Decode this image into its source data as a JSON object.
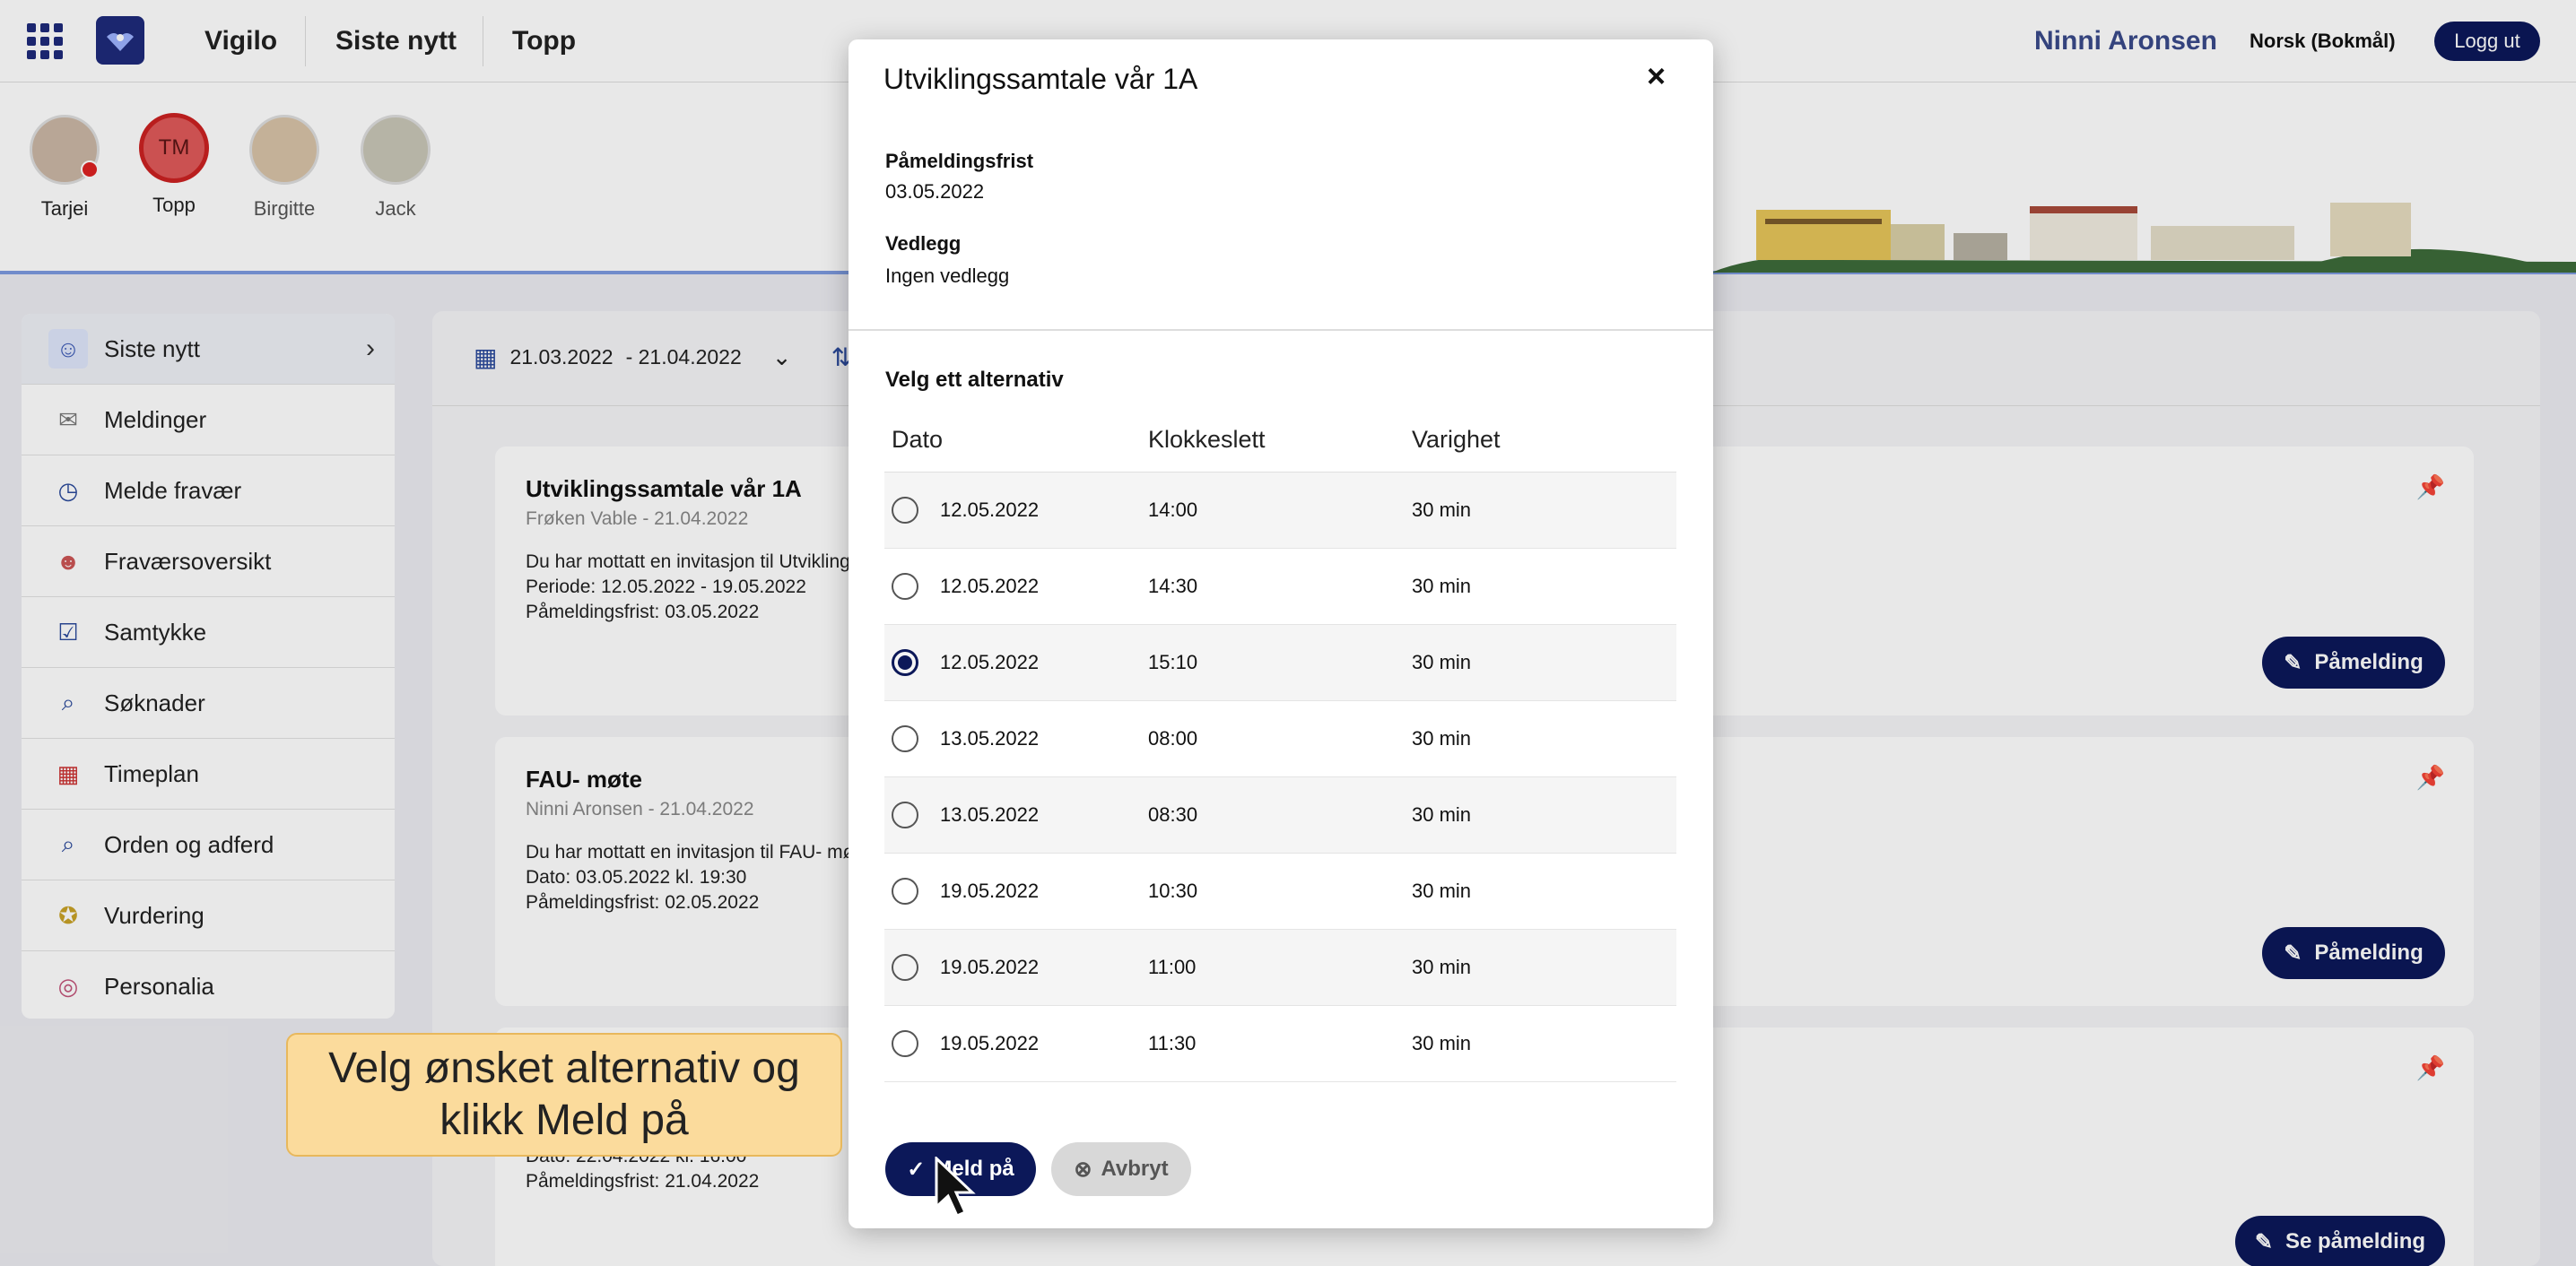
{
  "topnav": {
    "links": [
      "Vigilo",
      "Siste nytt",
      "Topp"
    ],
    "user": "Ninni Aronsen",
    "language": "Norsk (Bokmål)",
    "logout": "Logg ut"
  },
  "students": [
    {
      "name": "Tarjei"
    },
    {
      "name": "Topp",
      "initials": "TM"
    },
    {
      "name": "Birgitte"
    },
    {
      "name": "Jack"
    }
  ],
  "sidebar": {
    "items": [
      {
        "label": "Siste nytt",
        "icon": "news-person-icon"
      },
      {
        "label": "Meldinger",
        "icon": "envelope-icon"
      },
      {
        "label": "Melde fravær",
        "icon": "clock-icon"
      },
      {
        "label": "Fraværsoversikt",
        "icon": "absence-person-icon"
      },
      {
        "label": "Samtykke",
        "icon": "clipboard-icon"
      },
      {
        "label": "Søknader",
        "icon": "document-search-icon"
      },
      {
        "label": "Timeplan",
        "icon": "calendar-icon"
      },
      {
        "label": "Orden og adferd",
        "icon": "report-search-icon"
      },
      {
        "label": "Vurdering",
        "icon": "medal-icon"
      },
      {
        "label": "Personalia",
        "icon": "fingerprint-icon"
      }
    ]
  },
  "filter": {
    "date_from": "21.03.2022",
    "date_to": "- 21.04.2022"
  },
  "cards": [
    {
      "title": "Utviklingssamtale vår 1A",
      "sub": "Frøken Vable - 21.04.2022",
      "lines": [
        "Du har mottatt en invitasjon til Utvikling",
        "Periode: 12.05.2022 - 19.05.2022",
        "Påmeldingsfrist: 03.05.2022"
      ],
      "button": "Påmelding"
    },
    {
      "title": "FAU- møte",
      "sub": "Ninni Aronsen - 21.04.2022",
      "lines": [
        "Du har mottatt en invitasjon til FAU- mø",
        "Dato: 03.05.2022 kl. 19:30",
        "Påmeldingsfrist: 02.05.2022"
      ],
      "button": "Påmelding"
    },
    {
      "lines": [
        "Dato: 22.04.2022 kl. 16:00",
        "Påmeldingsfrist: 21.04.2022"
      ],
      "button": "Se påmelding"
    }
  ],
  "modal": {
    "title": "Utviklingssamtale vår 1A",
    "close": "×",
    "deadline_label": "Påmeldingsfrist",
    "deadline_value": "03.05.2022",
    "attachment_label": "Vedlegg",
    "attachment_value": "Ingen vedlegg",
    "choose_label": "Velg ett alternativ",
    "columns": [
      "Dato",
      "Klokkeslett",
      "Varighet"
    ],
    "rows": [
      {
        "date": "12.05.2022",
        "time": "14:00",
        "duration": "30 min",
        "selected": false
      },
      {
        "date": "12.05.2022",
        "time": "14:30",
        "duration": "30 min",
        "selected": false
      },
      {
        "date": "12.05.2022",
        "time": "15:10",
        "duration": "30 min",
        "selected": true
      },
      {
        "date": "13.05.2022",
        "time": "08:00",
        "duration": "30 min",
        "selected": false
      },
      {
        "date": "13.05.2022",
        "time": "08:30",
        "duration": "30 min",
        "selected": false
      },
      {
        "date": "19.05.2022",
        "time": "10:30",
        "duration": "30 min",
        "selected": false
      },
      {
        "date": "19.05.2022",
        "time": "11:00",
        "duration": "30 min",
        "selected": false
      },
      {
        "date": "19.05.2022",
        "time": "11:30",
        "duration": "30 min",
        "selected": false
      }
    ],
    "submit": "Meld på",
    "cancel": "Avbryt"
  },
  "tooltip": "Velg ønsket alternativ og klikk Meld på",
  "colors": {
    "brand": "#0c1859",
    "tooltip": "#fbdb9c",
    "accent_line": "#7d9ae0"
  }
}
